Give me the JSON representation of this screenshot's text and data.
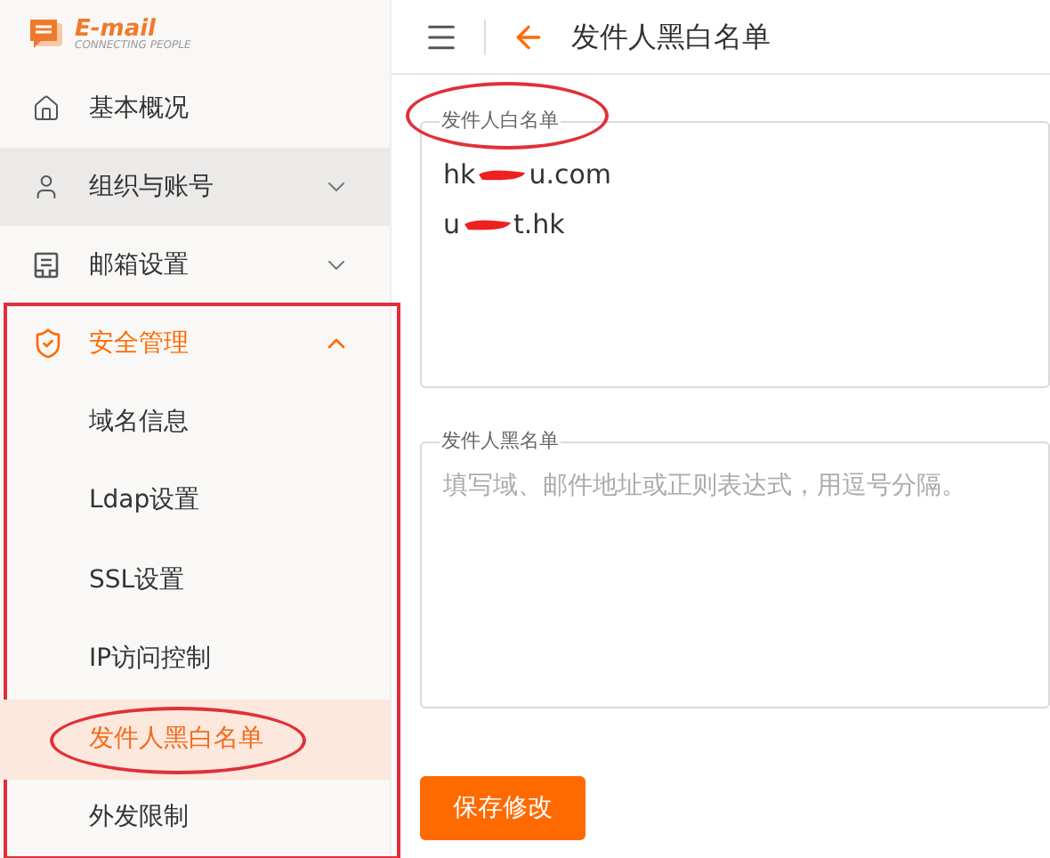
{
  "logo": {
    "title": "E-mail",
    "tagline": "CONNECTING PEOPLE"
  },
  "sidebar": {
    "items": [
      {
        "label": "基本概况",
        "selected": false
      },
      {
        "label": "组织与账号",
        "expanded": false,
        "selected": false,
        "hovered": true
      },
      {
        "label": "邮箱设置",
        "expanded": false,
        "selected": false
      },
      {
        "label": "安全管理",
        "expanded": true,
        "selected": true,
        "annotated": true,
        "children": [
          {
            "label": "域名信息",
            "selected": false
          },
          {
            "label": "Ldap设置",
            "selected": false
          },
          {
            "label": "SSL设置",
            "selected": false
          },
          {
            "label": "IP访问控制",
            "selected": false
          },
          {
            "label": "发件人黑白名单",
            "selected": true,
            "annotated": true
          },
          {
            "label": "外发限制",
            "selected": false
          }
        ]
      }
    ]
  },
  "header": {
    "title": "发件人黑白名单"
  },
  "fields": [
    {
      "label": "发件人白名单",
      "circled": true,
      "entries": [
        {
          "visible_start": "hk",
          "visible_end": "u.com",
          "redacted": true
        },
        {
          "visible_start": "u",
          "visible_end": "t.hk",
          "redacted": true
        }
      ]
    },
    {
      "label": "发件人黑名单",
      "placeholder": "填写域、邮件地址或正则表达式，用逗号分隔。"
    }
  ],
  "save_button": "保存修改"
}
